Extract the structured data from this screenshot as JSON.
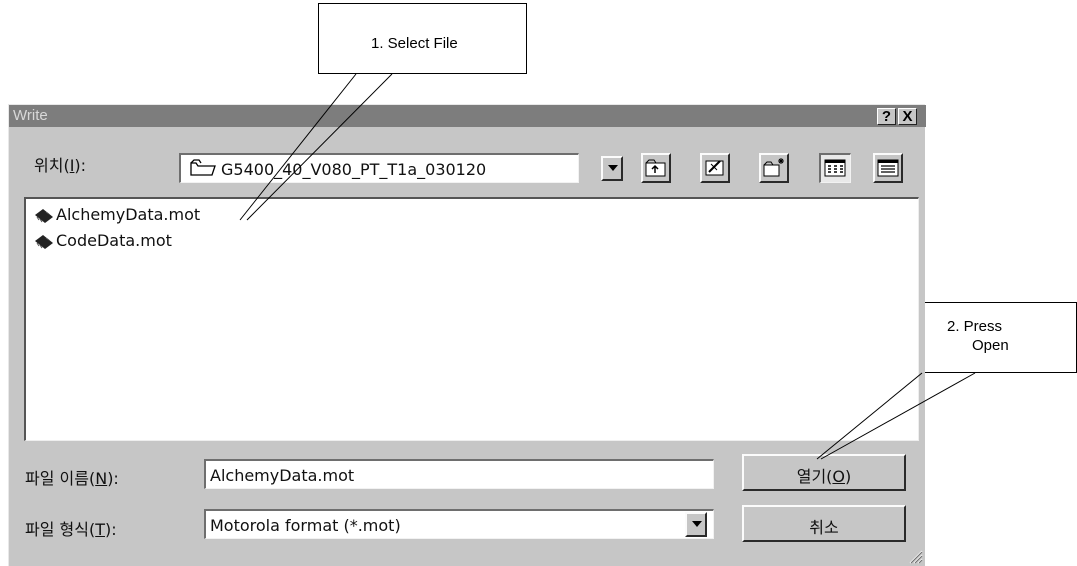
{
  "callouts": {
    "select_file": "1. Select File",
    "press_open_line1": "2. Press",
    "press_open_line2": "Open"
  },
  "dialog": {
    "title": "Write",
    "help_button": "?",
    "close_button": "X",
    "location_label_prefix": "위치(",
    "location_label_key": "I",
    "location_label_suffix": "):",
    "location_value": "G5400_40_V080_PT_T1a_030120",
    "files": [
      {
        "name": "AlchemyData.mot",
        "icon": "module-file-icon"
      },
      {
        "name": "CodeData.mot",
        "icon": "module-file-icon"
      }
    ],
    "filename_label_prefix": "파일 이름(",
    "filename_label_key": "N",
    "filename_label_suffix": "):",
    "filename_value": "AlchemyData.mot",
    "filetype_label_prefix": "파일 형식(",
    "filetype_label_key": "T",
    "filetype_label_suffix": "):",
    "filetype_value": "Motorola format (*.mot)",
    "open_button_prefix": "열기(",
    "open_button_key": "O",
    "open_button_suffix": ")",
    "cancel_button": "취소"
  }
}
